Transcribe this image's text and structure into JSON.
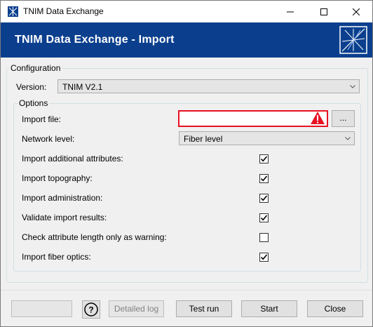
{
  "window": {
    "title": "TNIM Data Exchange",
    "controls": {
      "minimize": "minimize",
      "maximize": "maximize",
      "close": "close"
    }
  },
  "banner": {
    "title": "TNIM Data Exchange - Import",
    "background_color": "#0b3f8e"
  },
  "configuration": {
    "group_label": "Configuration",
    "version_label": "Version:",
    "version_value": "TNIM V2.1"
  },
  "options": {
    "group_label": "Options",
    "import_file_label": "Import file:",
    "import_file_value": "",
    "browse_label": "...",
    "network_level_label": "Network level:",
    "network_level_value": "Fiber level",
    "error_color": "#e81123",
    "checkboxes": [
      {
        "label": "Import additional attributes:",
        "checked": true
      },
      {
        "label": "Import topography:",
        "checked": true
      },
      {
        "label": "Import administration:",
        "checked": true
      },
      {
        "label": "Validate import results:",
        "checked": true
      },
      {
        "label": "Check attribute length only as warning:",
        "checked": false
      },
      {
        "label": "Import fiber optics:",
        "checked": true
      }
    ]
  },
  "footer": {
    "help_label": "?",
    "detailed_log_label": "Detailed log",
    "test_run_label": "Test run",
    "start_label": "Start",
    "close_label": "Close"
  }
}
